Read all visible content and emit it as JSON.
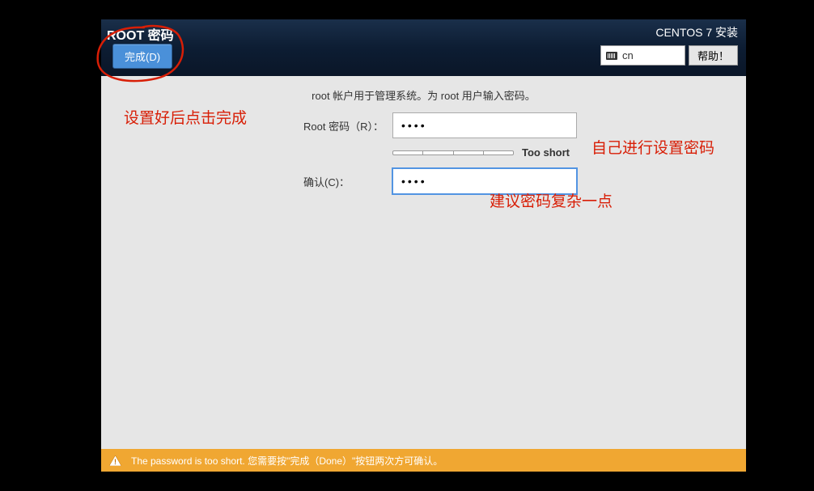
{
  "header": {
    "title": "ROOT 密码",
    "done_label": "完成(D)",
    "install_title": "CENTOS 7 安装",
    "lang_code": "cn",
    "help_label": "帮助！"
  },
  "form": {
    "description": "root 帐户用于管理系统。为 root 用户输入密码。",
    "password_label": "Root 密码（R）：",
    "password_value": "••••",
    "strength_text": "Too short",
    "confirm_label": "确认(C)：",
    "confirm_value": "••••"
  },
  "footer": {
    "warning_text": "The password is too short. 您需要按\"完成（Done）\"按钮两次方可确认。"
  },
  "annotations": {
    "a1": "设置好后点击完成",
    "a2": "自己进行设置密码",
    "a3": "建议密码复杂一点"
  }
}
